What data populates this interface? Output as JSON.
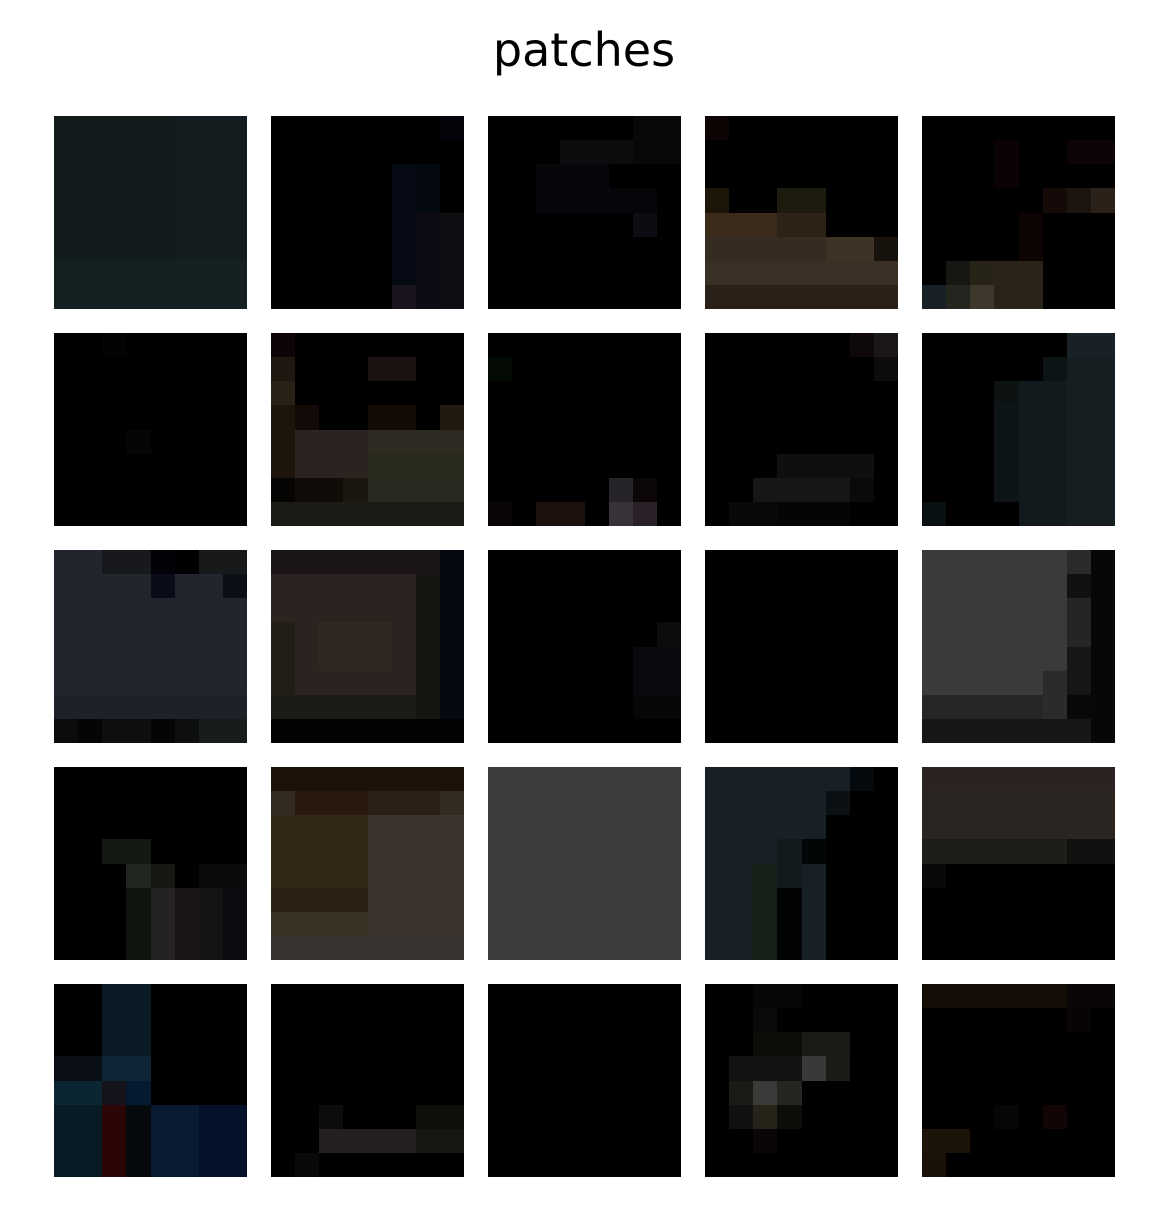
{
  "title": "patches",
  "grid": {
    "rows": 5,
    "cols": 5,
    "pixels_per_patch": 8
  },
  "patches": [
    {
      "id": "r1c1",
      "base": "#121b1c",
      "blocks": [
        [
          0,
          0,
          8,
          8,
          "#111b1b"
        ],
        [
          5,
          0,
          3,
          8,
          "#131c1e"
        ],
        [
          0,
          6,
          8,
          2,
          "#142022"
        ]
      ]
    },
    {
      "id": "r1c2",
      "base": "#000000",
      "blocks": [
        [
          7,
          0,
          1,
          1,
          "#06020a"
        ],
        [
          5,
          2,
          1,
          6,
          "#060a14"
        ],
        [
          6,
          2,
          1,
          2,
          "#040810"
        ],
        [
          6,
          4,
          1,
          4,
          "#0d0c14"
        ],
        [
          5,
          7,
          1,
          1,
          "#19141d"
        ],
        [
          7,
          4,
          1,
          4,
          "#0f0e12"
        ]
      ]
    },
    {
      "id": "r1c3",
      "base": "#000000",
      "blocks": [
        [
          3,
          1,
          3,
          1,
          "#0c0c0f"
        ],
        [
          6,
          0,
          2,
          2,
          "#08080b"
        ],
        [
          2,
          2,
          3,
          2,
          "#07070b"
        ],
        [
          5,
          3,
          2,
          1,
          "#050609"
        ],
        [
          6,
          4,
          1,
          1,
          "#0e0c12"
        ]
      ]
    },
    {
      "id": "r1c4",
      "base": "#000000",
      "blocks": [
        [
          0,
          0,
          1,
          1,
          "#0d0404"
        ],
        [
          0,
          3,
          1,
          1,
          "#1d1608"
        ],
        [
          3,
          3,
          2,
          1,
          "#1d1a0e"
        ],
        [
          0,
          4,
          3,
          1,
          "#3a2b1b"
        ],
        [
          3,
          4,
          2,
          1,
          "#2c2316"
        ],
        [
          0,
          5,
          8,
          1,
          "#352b20"
        ],
        [
          5,
          5,
          2,
          1,
          "#3f3326"
        ],
        [
          7,
          5,
          1,
          1,
          "#17120b"
        ],
        [
          0,
          6,
          8,
          1,
          "#3a3025"
        ],
        [
          0,
          7,
          8,
          1,
          "#2a2018"
        ]
      ]
    },
    {
      "id": "r1c5",
      "base": "#000000",
      "blocks": [
        [
          3,
          1,
          1,
          2,
          "#0b0303"
        ],
        [
          6,
          1,
          2,
          1,
          "#0e0405"
        ],
        [
          5,
          3,
          1,
          1,
          "#150a08"
        ],
        [
          6,
          3,
          1,
          1,
          "#1c140e"
        ],
        [
          7,
          3,
          1,
          1,
          "#2b2118"
        ],
        [
          4,
          4,
          1,
          2,
          "#0f0404"
        ],
        [
          1,
          6,
          1,
          1,
          "#161612"
        ],
        [
          2,
          6,
          1,
          2,
          "#272317"
        ],
        [
          3,
          6,
          2,
          2,
          "#2a2317"
        ],
        [
          0,
          7,
          1,
          1,
          "#172025"
        ],
        [
          1,
          7,
          1,
          1,
          "#25251f"
        ],
        [
          2,
          7,
          1,
          1,
          "#3e372b"
        ]
      ]
    },
    {
      "id": "r2c1",
      "base": "#000000",
      "blocks": [
        [
          2,
          0,
          1,
          1,
          "#030303"
        ],
        [
          3,
          4,
          1,
          1,
          "#040604"
        ]
      ]
    },
    {
      "id": "r2c2",
      "base": "#000000",
      "blocks": [
        [
          0,
          0,
          1,
          1,
          "#0c0408"
        ],
        [
          0,
          1,
          1,
          1,
          "#201810"
        ],
        [
          0,
          2,
          1,
          1,
          "#2a2116"
        ],
        [
          0,
          3,
          1,
          3,
          "#1d150c"
        ],
        [
          1,
          3,
          1,
          1,
          "#120a06"
        ],
        [
          4,
          1,
          2,
          1,
          "#1b1111"
        ],
        [
          4,
          3,
          2,
          1,
          "#120b06"
        ],
        [
          7,
          3,
          1,
          1,
          "#22190f"
        ],
        [
          1,
          4,
          3,
          2,
          "#2a231f"
        ],
        [
          4,
          4,
          4,
          2,
          "#2e2b22"
        ],
        [
          4,
          5,
          4,
          1,
          "#2a2a1c"
        ],
        [
          0,
          6,
          1,
          1,
          "#050403"
        ],
        [
          1,
          6,
          2,
          1,
          "#100d08"
        ],
        [
          3,
          6,
          1,
          1,
          "#1b170e"
        ],
        [
          4,
          6,
          4,
          1,
          "#262a20"
        ],
        [
          0,
          7,
          8,
          1,
          "#1b1a14"
        ]
      ]
    },
    {
      "id": "r2c3",
      "base": "#000000",
      "blocks": [
        [
          0,
          1,
          1,
          1,
          "#040a04"
        ],
        [
          0,
          7,
          1,
          1,
          "#0b0507"
        ],
        [
          2,
          7,
          2,
          1,
          "#1c110d"
        ],
        [
          5,
          6,
          1,
          1,
          "#27232a"
        ],
        [
          5,
          7,
          1,
          1,
          "#373139"
        ],
        [
          6,
          7,
          1,
          1,
          "#2a2028"
        ],
        [
          6,
          6,
          1,
          1,
          "#0c0608"
        ]
      ]
    },
    {
      "id": "r2c4",
      "base": "#000000",
      "blocks": [
        [
          6,
          0,
          1,
          1,
          "#0e0809"
        ],
        [
          7,
          0,
          1,
          1,
          "#1b1617"
        ],
        [
          7,
          1,
          1,
          1,
          "#0e0b0c"
        ],
        [
          3,
          5,
          4,
          1,
          "#0f0e10"
        ],
        [
          2,
          6,
          4,
          1,
          "#171518"
        ],
        [
          6,
          6,
          1,
          1,
          "#0b0a0b"
        ],
        [
          1,
          7,
          2,
          1,
          "#0a090a"
        ],
        [
          3,
          7,
          3,
          1,
          "#050508"
        ]
      ]
    },
    {
      "id": "r2c5",
      "base": "#000000",
      "blocks": [
        [
          6,
          0,
          2,
          1,
          "#182226"
        ],
        [
          5,
          1,
          1,
          1,
          "#0c1416"
        ],
        [
          6,
          1,
          2,
          7,
          "#171e22"
        ],
        [
          3,
          2,
          1,
          1,
          "#0d1312"
        ],
        [
          4,
          2,
          2,
          1,
          "#111b1e"
        ],
        [
          3,
          3,
          1,
          4,
          "#0e1518"
        ],
        [
          4,
          3,
          2,
          5,
          "#131a1e"
        ],
        [
          0,
          7,
          1,
          1,
          "#081012"
        ]
      ]
    },
    {
      "id": "r3c1",
      "base": "#22252e",
      "blocks": [
        [
          0,
          0,
          2,
          1,
          "#22252e"
        ],
        [
          2,
          0,
          2,
          1,
          "#18191d"
        ],
        [
          4,
          0,
          1,
          1,
          "#020208"
        ],
        [
          5,
          0,
          1,
          1,
          "#000000"
        ],
        [
          6,
          0,
          2,
          1,
          "#18191b"
        ],
        [
          4,
          1,
          1,
          1,
          "#090c18"
        ],
        [
          7,
          1,
          1,
          1,
          "#0c0f16"
        ],
        [
          0,
          6,
          8,
          1,
          "#1f2128"
        ],
        [
          0,
          7,
          1,
          1,
          "#0c0c0c"
        ],
        [
          1,
          7,
          1,
          1,
          "#050505"
        ],
        [
          2,
          7,
          2,
          1,
          "#0e0f0e"
        ],
        [
          4,
          7,
          1,
          1,
          "#050505"
        ],
        [
          5,
          7,
          1,
          1,
          "#0d0e0f"
        ],
        [
          6,
          7,
          2,
          1,
          "#181c1d"
        ]
      ]
    },
    {
      "id": "r3c2",
      "base": "#2a2320",
      "blocks": [
        [
          0,
          0,
          8,
          1,
          "#1b1518"
        ],
        [
          7,
          0,
          1,
          7,
          "#060a10"
        ],
        [
          6,
          1,
          1,
          6,
          "#161510"
        ],
        [
          0,
          3,
          1,
          3,
          "#231d17"
        ],
        [
          2,
          3,
          3,
          2,
          "#302720"
        ],
        [
          0,
          6,
          6,
          1,
          "#1c1b17"
        ],
        [
          0,
          7,
          8,
          1,
          "#030303"
        ]
      ]
    },
    {
      "id": "r3c3",
      "base": "#000000",
      "blocks": [
        [
          7,
          3,
          1,
          1,
          "#0c0c0d"
        ],
        [
          6,
          4,
          2,
          2,
          "#0a0a0e"
        ],
        [
          6,
          6,
          2,
          1,
          "#060609"
        ]
      ]
    },
    {
      "id": "r3c4",
      "base": "#000000",
      "blocks": [
        [
          0,
          0,
          8,
          8,
          "#010102"
        ]
      ]
    },
    {
      "id": "r3c5",
      "base": "#3b3a39",
      "blocks": [
        [
          6,
          0,
          1,
          1,
          "#2c2a2b"
        ],
        [
          7,
          0,
          1,
          8,
          "#070707"
        ],
        [
          6,
          1,
          1,
          1,
          "#111012"
        ],
        [
          6,
          2,
          1,
          2,
          "#252527"
        ],
        [
          6,
          4,
          1,
          2,
          "#161616"
        ],
        [
          5,
          5,
          1,
          2,
          "#2b2b29"
        ],
        [
          6,
          6,
          1,
          1,
          "#080808"
        ],
        [
          0,
          6,
          5,
          1,
          "#262624"
        ],
        [
          0,
          7,
          7,
          1,
          "#161816"
        ]
      ]
    },
    {
      "id": "r4c1",
      "base": "#000000",
      "blocks": [
        [
          2,
          3,
          2,
          1,
          "#121a12"
        ],
        [
          3,
          4,
          1,
          1,
          "#222621"
        ],
        [
          4,
          4,
          1,
          1,
          "#171813"
        ],
        [
          6,
          4,
          2,
          1,
          "#0b0c0a"
        ],
        [
          3,
          5,
          1,
          3,
          "#0f140c"
        ],
        [
          4,
          5,
          1,
          3,
          "#252223"
        ],
        [
          5,
          5,
          1,
          3,
          "#1a1317"
        ],
        [
          6,
          5,
          1,
          3,
          "#161315"
        ],
        [
          7,
          5,
          1,
          3,
          "#0d0a10"
        ]
      ]
    },
    {
      "id": "r4c2",
      "base": "#332a22",
      "blocks": [
        [
          0,
          0,
          8,
          1,
          "#1d1207"
        ],
        [
          1,
          1,
          3,
          1,
          "#271a0c"
        ],
        [
          4,
          1,
          3,
          1,
          "#2b2016"
        ],
        [
          0,
          2,
          4,
          3,
          "#332816"
        ],
        [
          4,
          2,
          4,
          5,
          "#3a342c"
        ],
        [
          0,
          5,
          4,
          1,
          "#2c2214"
        ],
        [
          0,
          6,
          4,
          1,
          "#3a3225"
        ],
        [
          0,
          7,
          8,
          1,
          "#37332e"
        ]
      ]
    },
    {
      "id": "r4c3",
      "base": "#3c3b39",
      "blocks": [
        [
          0,
          0,
          8,
          8,
          "#3d3c3a"
        ]
      ]
    },
    {
      "id": "r4c4",
      "base": "#000000",
      "blocks": [
        [
          0,
          0,
          6,
          1,
          "#172024"
        ],
        [
          6,
          0,
          1,
          1,
          "#050a0e"
        ],
        [
          0,
          1,
          5,
          7,
          "#172024"
        ],
        [
          5,
          1,
          1,
          1,
          "#0a1014"
        ],
        [
          3,
          3,
          1,
          2,
          "#131a1e"
        ],
        [
          4,
          3,
          1,
          1,
          "#030606"
        ],
        [
          2,
          4,
          1,
          4,
          "#162018"
        ],
        [
          3,
          5,
          1,
          3,
          "#020305"
        ]
      ]
    },
    {
      "id": "r4c5",
      "base": "#000000",
      "blocks": [
        [
          0,
          0,
          8,
          1,
          "#2a2321"
        ],
        [
          0,
          1,
          8,
          2,
          "#2b2521"
        ],
        [
          0,
          3,
          8,
          1,
          "#1f1d1a"
        ],
        [
          6,
          3,
          2,
          1,
          "#121110"
        ],
        [
          0,
          4,
          1,
          1,
          "#080a08"
        ]
      ]
    },
    {
      "id": "r5c1",
      "base": "#000000",
      "blocks": [
        [
          2,
          0,
          2,
          3,
          "#0a1a24"
        ],
        [
          0,
          3,
          2,
          1,
          "#0a0f16"
        ],
        [
          2,
          3,
          2,
          1,
          "#0d2534"
        ],
        [
          0,
          4,
          2,
          1,
          "#0c2532"
        ],
        [
          2,
          4,
          1,
          1,
          "#14121a"
        ],
        [
          3,
          4,
          1,
          1,
          "#051a30"
        ],
        [
          0,
          5,
          2,
          3,
          "#081a24"
        ],
        [
          2,
          5,
          1,
          3,
          "#2c0506"
        ],
        [
          3,
          5,
          1,
          3,
          "#060a0c"
        ],
        [
          4,
          5,
          4,
          3,
          "#0a1a30"
        ],
        [
          6,
          5,
          2,
          3,
          "#05102a"
        ]
      ]
    },
    {
      "id": "r5c2",
      "base": "#000000",
      "blocks": [
        [
          2,
          5,
          1,
          1,
          "#0c0c0a"
        ],
        [
          2,
          6,
          4,
          1,
          "#231f23"
        ],
        [
          6,
          5,
          2,
          1,
          "#0e0e0a"
        ],
        [
          6,
          6,
          2,
          1,
          "#171611"
        ],
        [
          1,
          7,
          1,
          1,
          "#080a08"
        ]
      ]
    },
    {
      "id": "r5c3",
      "base": "#000000",
      "blocks": [
        [
          0,
          0,
          8,
          8,
          "#000000"
        ]
      ]
    },
    {
      "id": "r5c4",
      "base": "#000000",
      "blocks": [
        [
          2,
          0,
          2,
          1,
          "#060507"
        ],
        [
          2,
          1,
          1,
          1,
          "#0b0a08"
        ],
        [
          2,
          2,
          2,
          1,
          "#0d0c08"
        ],
        [
          4,
          2,
          2,
          1,
          "#1b1a15"
        ],
        [
          1,
          3,
          3,
          1,
          "#121210"
        ],
        [
          4,
          3,
          1,
          1,
          "#3a3937"
        ],
        [
          5,
          3,
          1,
          1,
          "#1c1b16"
        ],
        [
          1,
          4,
          1,
          1,
          "#1b1a17"
        ],
        [
          2,
          4,
          1,
          1,
          "#3b3a38"
        ],
        [
          3,
          4,
          1,
          1,
          "#252622"
        ],
        [
          1,
          5,
          1,
          1,
          "#121010"
        ],
        [
          2,
          5,
          1,
          1,
          "#262419"
        ],
        [
          3,
          5,
          1,
          1,
          "#0d0d09"
        ],
        [
          2,
          6,
          1,
          1,
          "#0a0608"
        ]
      ]
    },
    {
      "id": "r5c5",
      "base": "#000000",
      "blocks": [
        [
          0,
          0,
          6,
          1,
          "#140d06"
        ],
        [
          6,
          0,
          2,
          1,
          "#0a0506"
        ],
        [
          6,
          1,
          1,
          1,
          "#080406"
        ],
        [
          3,
          5,
          1,
          1,
          "#080506"
        ],
        [
          5,
          5,
          1,
          1,
          "#130506"
        ],
        [
          0,
          6,
          2,
          1,
          "#1c1409"
        ],
        [
          0,
          7,
          1,
          1,
          "#1a1208"
        ]
      ]
    }
  ]
}
